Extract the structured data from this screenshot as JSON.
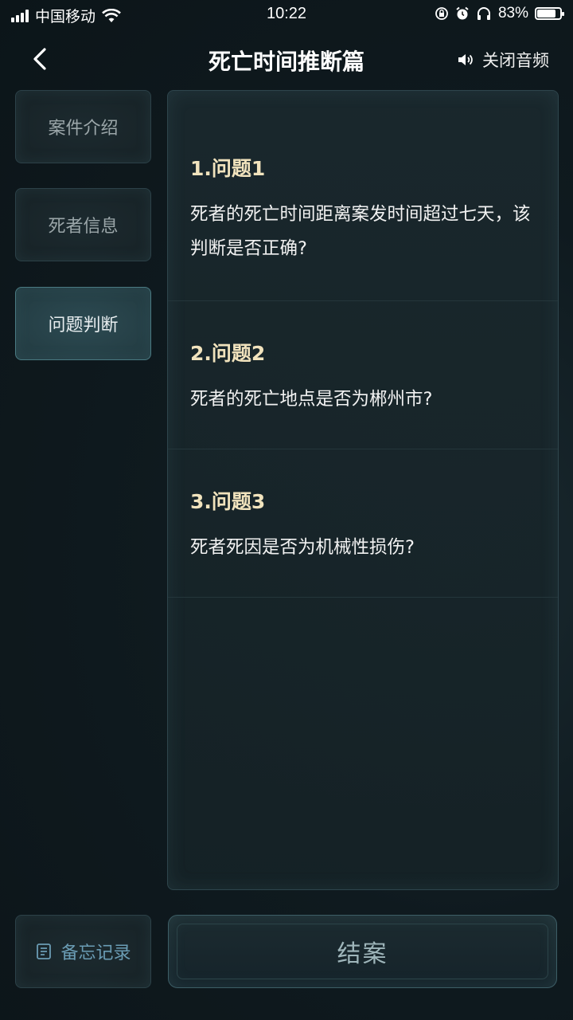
{
  "status": {
    "carrier": "中国移动",
    "time": "10:22",
    "battery_pct": "83%",
    "battery_level": 0.83
  },
  "nav": {
    "title": "死亡时间推断篇",
    "audio_label": "关闭音频"
  },
  "sidebar": {
    "items": [
      {
        "label": "案件介绍",
        "active": false
      },
      {
        "label": "死者信息",
        "active": false
      },
      {
        "label": "问题判断",
        "active": true
      }
    ],
    "memo_label": "备忘记录"
  },
  "questions": [
    {
      "title": "1.问题1",
      "text": "死者的死亡时间距离案发时间超过七天，该判断是否正确?"
    },
    {
      "title": "2.问题2",
      "text": "死者的死亡地点是否为郴州市?"
    },
    {
      "title": "3.问题3",
      "text": "死者死因是否为机械性损伤?"
    }
  ],
  "close_case_label": "结案",
  "colors": {
    "accent_gold": "#f1e3bd",
    "memo_blue": "#6a9cb4"
  }
}
